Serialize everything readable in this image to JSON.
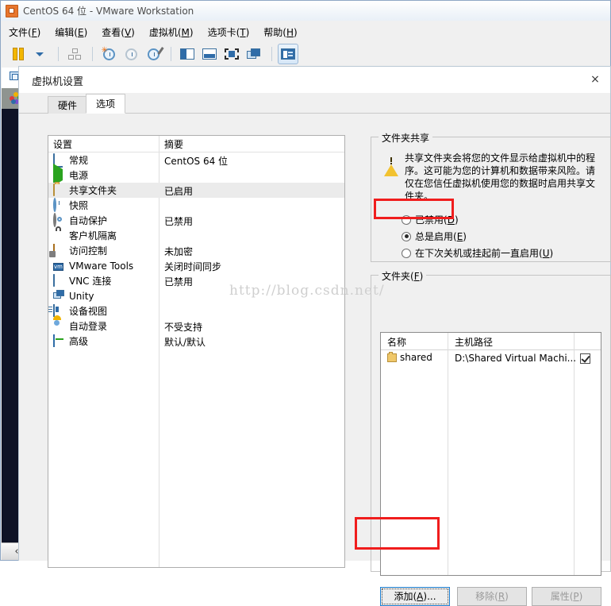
{
  "window": {
    "title": "CentOS 64 位 - VMware Workstation",
    "icon": "vmware-app-icon"
  },
  "menu": {
    "items": [
      {
        "label": "文件(F)",
        "text": "文件(",
        "accel": "F",
        "tail": ")"
      },
      {
        "label": "编辑(E)",
        "text": "编辑(",
        "accel": "E",
        "tail": ")"
      },
      {
        "label": "查看(V)",
        "text": "查看(",
        "accel": "V",
        "tail": ")"
      },
      {
        "label": "虚拟机(M)",
        "text": "虚拟机(",
        "accel": "M",
        "tail": ")"
      },
      {
        "label": "选项卡(T)",
        "text": "选项卡(",
        "accel": "T",
        "tail": ")"
      },
      {
        "label": "帮助(H)",
        "text": "帮助(",
        "accel": "H",
        "tail": ")"
      }
    ]
  },
  "toolbar": {
    "buttons": [
      "suspend-icon",
      "dropdown-caret-icon",
      "network-editor-icon",
      "snapshot-take-icon",
      "snapshot-revert-icon",
      "snapshot-manager-icon",
      "show-sidebar-icon",
      "show-thumbnail-bar-icon",
      "fullscreen-icon",
      "unity-mode-icon",
      "console-view-icon"
    ]
  },
  "sidebar": {
    "tabs": [
      "vm-running-icon",
      "home-flower-icon"
    ],
    "collapse_label": "‹"
  },
  "dialog": {
    "title": "虚拟机设置",
    "close_label": "×",
    "tabs": [
      {
        "label": "硬件",
        "active": false
      },
      {
        "label": "选项",
        "active": true
      }
    ]
  },
  "settings_list": {
    "headers": {
      "name": "设置",
      "summary": "摘要"
    },
    "rows": [
      {
        "icon": "general-icon",
        "label": "常规",
        "summary": "CentOS 64 位",
        "selected": false
      },
      {
        "icon": "power-icon",
        "label": "电源",
        "summary": "",
        "selected": false
      },
      {
        "icon": "shared-folders-icon",
        "label": "共享文件夹",
        "summary": "已启用",
        "selected": true
      },
      {
        "icon": "snapshot-icon",
        "label": "快照",
        "summary": "",
        "selected": false
      },
      {
        "icon": "autoprotect-icon",
        "label": "自动保护",
        "summary": "已禁用",
        "selected": false
      },
      {
        "icon": "guest-isolation-icon",
        "label": "客户机隔离",
        "summary": "",
        "selected": false
      },
      {
        "icon": "access-control-icon",
        "label": "访问控制",
        "summary": "未加密",
        "selected": false
      },
      {
        "icon": "vmware-tools-icon",
        "label": "VMware Tools",
        "summary": "关闭时间同步",
        "selected": false
      },
      {
        "icon": "vnc-icon",
        "label": "VNC 连接",
        "summary": "已禁用",
        "selected": false
      },
      {
        "icon": "unity-icon",
        "label": "Unity",
        "summary": "",
        "selected": false
      },
      {
        "icon": "device-view-icon",
        "label": "设备视图",
        "summary": "",
        "selected": false
      },
      {
        "icon": "autologin-icon",
        "label": "自动登录",
        "summary": "不受支持",
        "selected": false
      },
      {
        "icon": "advanced-icon",
        "label": "高级",
        "summary": "默认/默认",
        "selected": false
      }
    ]
  },
  "folder_sharing": {
    "group_title": "文件夹共享",
    "warning_icon": "warning-triangle-icon",
    "warning_text": "共享文件夹会将您的文件显示给虚拟机中的程序。这可能为您的计算机和数据带来风险。请仅在您信任虚拟机使用您的数据时启用共享文件夹。",
    "options": [
      {
        "label": "已禁用(D)",
        "text": "已禁用(",
        "accel": "D",
        "tail": ")",
        "checked": false
      },
      {
        "label": "总是启用(E)",
        "text": "总是启用(",
        "accel": "E",
        "tail": ")",
        "checked": true
      },
      {
        "label": "在下次关机或挂起前一直启用(U)",
        "text": "在下次关机或挂起前一直启用(",
        "accel": "U",
        "tail": ")",
        "checked": false
      }
    ]
  },
  "folders": {
    "group_title": "文件夹(F)",
    "group_text": "文件夹(",
    "group_accel": "F",
    "group_tail": ")",
    "columns": {
      "name": "名称",
      "path": "主机路径"
    },
    "rows": [
      {
        "icon": "folder-icon",
        "name": "shared",
        "path": "D:\\Shared Virtual Machi...",
        "enabled": true
      }
    ]
  },
  "buttons": {
    "add": {
      "label": "添加(A)...",
      "text": "添加(",
      "accel": "A",
      "tail": ")...",
      "enabled": true,
      "focused": true
    },
    "remove": {
      "label": "移除(R)",
      "text": "移除(",
      "accel": "R",
      "tail": ")",
      "enabled": false,
      "focused": false
    },
    "props": {
      "label": "属性(P)",
      "text": "属性(",
      "accel": "P",
      "tail": ")",
      "enabled": false,
      "focused": false
    }
  },
  "annotations": {
    "color": "#f01d1d",
    "boxes": [
      "always-enabled-radio-highlight",
      "add-button-highlight"
    ]
  },
  "watermark": {
    "text": "http://blog.csdn.net/"
  }
}
